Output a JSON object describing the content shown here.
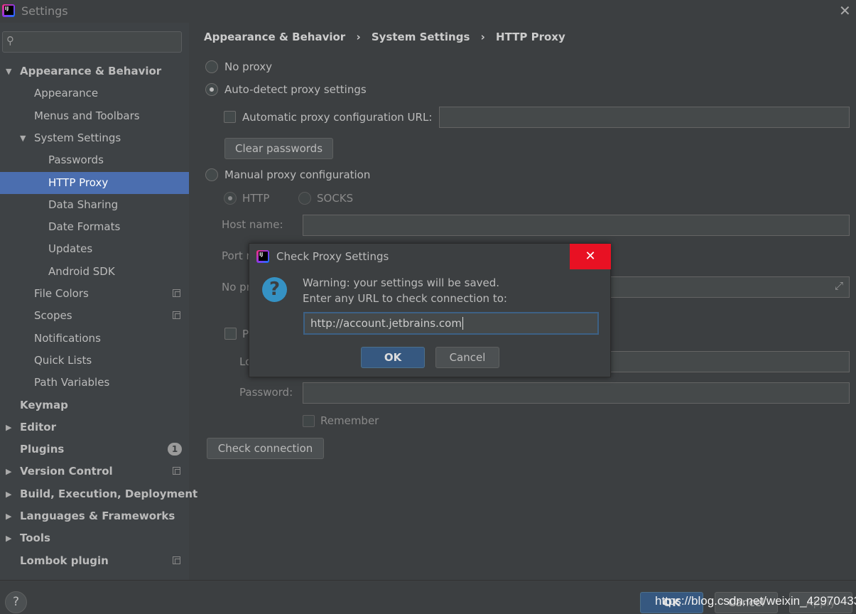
{
  "window": {
    "title": "Settings",
    "close_icon": "close-icon"
  },
  "search": {
    "placeholder": "",
    "value": ""
  },
  "sidebar": {
    "items": [
      {
        "label": "Appearance & Behavior",
        "level": 0,
        "bold": true,
        "expanded": true
      },
      {
        "label": "Appearance",
        "level": 1
      },
      {
        "label": "Menus and Toolbars",
        "level": 1
      },
      {
        "label": "System Settings",
        "level": 1,
        "expanded": true
      },
      {
        "label": "Passwords",
        "level": 2
      },
      {
        "label": "HTTP Proxy",
        "level": 2,
        "selected": true
      },
      {
        "label": "Data Sharing",
        "level": 2
      },
      {
        "label": "Date Formats",
        "level": 2
      },
      {
        "label": "Updates",
        "level": 2
      },
      {
        "label": "Android SDK",
        "level": 2
      },
      {
        "label": "File Colors",
        "level": 1,
        "project": true
      },
      {
        "label": "Scopes",
        "level": 1,
        "project": true
      },
      {
        "label": "Notifications",
        "level": 1
      },
      {
        "label": "Quick Lists",
        "level": 1
      },
      {
        "label": "Path Variables",
        "level": 1
      },
      {
        "label": "Keymap",
        "level": 0,
        "bold": true
      },
      {
        "label": "Editor",
        "level": 0,
        "bold": true,
        "expanded": false
      },
      {
        "label": "Plugins",
        "level": 0,
        "bold": true,
        "badge": "1"
      },
      {
        "label": "Version Control",
        "level": 0,
        "bold": true,
        "expanded": false,
        "project": true
      },
      {
        "label": "Build, Execution, Deployment",
        "level": 0,
        "bold": true,
        "expanded": false
      },
      {
        "label": "Languages & Frameworks",
        "level": 0,
        "bold": true,
        "expanded": false
      },
      {
        "label": "Tools",
        "level": 0,
        "bold": true,
        "expanded": false
      },
      {
        "label": "Lombok plugin",
        "level": 0,
        "bold": true,
        "project": true
      }
    ]
  },
  "breadcrumb": [
    "Appearance & Behavior",
    "System Settings",
    "HTTP Proxy"
  ],
  "proxy": {
    "no_proxy": "No proxy",
    "auto_detect": "Auto-detect proxy settings",
    "auto_url_label": "Automatic proxy configuration URL:",
    "auto_url_value": "",
    "clear_passwords": "Clear passwords",
    "manual": "Manual proxy configuration",
    "http": "HTTP",
    "socks": "SOCKS",
    "host_label": "Host name:",
    "port_label": "Port n",
    "no_proxy_for_label": "No pr",
    "auth_label": "P",
    "login_label": "Lo",
    "password_label": "Password:",
    "remember": "Remember",
    "check_connection": "Check connection",
    "selected": "auto_detect"
  },
  "dialog": {
    "title": "Check Proxy Settings",
    "line1": "Warning: your settings will be saved.",
    "line2": "Enter any URL to check connection to:",
    "url_value": "http://account.jetbrains.com",
    "ok": "OK",
    "cancel": "Cancel"
  },
  "footer": {
    "help": "?",
    "ok": "OK",
    "cancel": "Cancel",
    "apply": "Apply",
    "watermark": "https://blog.csdn.net/weixin_42970433"
  },
  "colors": {
    "selection": "#4b6eaf",
    "dialog_close": "#e81123",
    "default_button": "#365880",
    "question_icon": "#3592c4"
  }
}
